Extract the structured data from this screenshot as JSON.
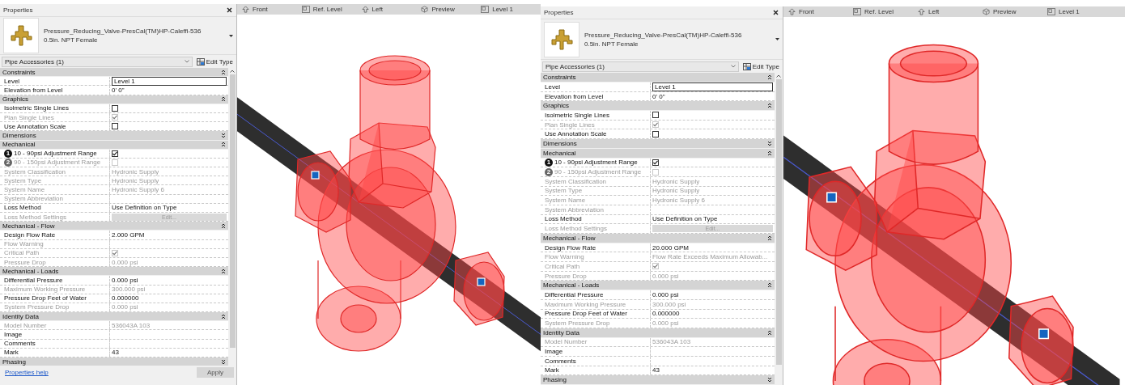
{
  "screens": [
    {
      "panel": {
        "title": "Properties",
        "family": "Pressure_Reducing_Valve-PresCal(TM)HP-Caleffi-536",
        "type": "0.5in. NPT Female",
        "category": "Pipe Accessories (1)",
        "edit_type": "Edit Type",
        "groups": [
          {
            "name": "Constraints",
            "expanded": true,
            "rows": [
              {
                "label": "Level",
                "kind": "field",
                "value": "Level 1",
                "disabled": false
              },
              {
                "label": "Elevation from Level",
                "kind": "text",
                "value": "0'  0\"",
                "disabled": false
              }
            ]
          },
          {
            "name": "Graphics",
            "expanded": true,
            "rows": [
              {
                "label": "Isolmetric Single Lines",
                "kind": "checkbox",
                "checked": false,
                "disabled": false
              },
              {
                "label": "Plan Single Lines",
                "kind": "checkbox",
                "checked": true,
                "disabled": true
              },
              {
                "label": "Use Annotation Scale",
                "kind": "checkbox",
                "checked": false,
                "disabled": false
              }
            ]
          },
          {
            "name": "Dimensions",
            "expanded": false
          },
          {
            "name": "Mechanical",
            "expanded": true,
            "rows": [
              {
                "label": "10 - 90psi Adjustment Range",
                "badge": "1",
                "kind": "checkbox",
                "checked": true,
                "disabled": false
              },
              {
                "label": "90 - 150psi Adjustment Range",
                "badge": "2",
                "kind": "checkbox",
                "checked": false,
                "disabled": true
              },
              {
                "label": "System Classification",
                "kind": "text",
                "value": "Hydronic Supply",
                "disabled": true
              },
              {
                "label": "System Type",
                "kind": "text",
                "value": "Hydronic Supply",
                "disabled": true
              },
              {
                "label": "System Name",
                "kind": "text",
                "value": "Hydronic Supply 6",
                "disabled": true
              },
              {
                "label": "System Abbreviation",
                "kind": "text",
                "disabled": true
              },
              {
                "label": "Loss Method",
                "kind": "text",
                "value": "Use Definition on Type",
                "disabled": false
              },
              {
                "label": "Loss Method Settings",
                "kind": "button",
                "value": "Edit...",
                "disabled": true
              }
            ]
          },
          {
            "name": "Mechanical - Flow",
            "expanded": true,
            "rows": [
              {
                "label": "Design Flow Rate",
                "kind": "text",
                "value": "2.000 GPM",
                "disabled": false
              },
              {
                "label": "Flow Warning",
                "kind": "text",
                "disabled": true
              },
              {
                "label": "Critical Path",
                "kind": "checkbox",
                "checked": true,
                "disabled": true
              },
              {
                "label": "Pressure Drop",
                "kind": "text",
                "value": "0.000 psi",
                "disabled": true
              }
            ]
          },
          {
            "name": "Mechanical - Loads",
            "expanded": true,
            "rows": [
              {
                "label": "Differential Pressure",
                "kind": "text",
                "value": "0.000 psi",
                "disabled": false
              },
              {
                "label": "Maximum Working Pressure",
                "kind": "text",
                "value": "300.000 psi",
                "disabled": true
              },
              {
                "label": "Pressure Drop Feet of Water",
                "kind": "text",
                "value": "0.000000",
                "disabled": false
              },
              {
                "label": "System Pressure Drop",
                "kind": "text",
                "value": "0.000 psi",
                "disabled": true
              }
            ]
          },
          {
            "name": "Identity Data",
            "expanded": true,
            "rows": [
              {
                "label": "Model Number",
                "kind": "text",
                "value": "536043A 103",
                "disabled": true
              },
              {
                "label": "Image",
                "kind": "text",
                "disabled": false
              },
              {
                "label": "Comments",
                "kind": "text",
                "disabled": false
              },
              {
                "label": "Mark",
                "kind": "text",
                "value": "43",
                "disabled": false
              }
            ]
          },
          {
            "name": "Phasing",
            "expanded": false
          }
        ],
        "footer": {
          "help_link": "Properties help",
          "apply": {
            "label": "Apply",
            "disabled": true
          }
        }
      },
      "viewport": {
        "tabs": [
          {
            "label": "Front"
          },
          {
            "label": "Ref. Level"
          },
          {
            "label": "Left"
          },
          {
            "label": "Preview"
          },
          {
            "label": "Level 1"
          }
        ]
      }
    },
    {
      "panel": {
        "title": "Properties",
        "family": "Pressure_Reducing_Valve-PresCal(TM)HP-Caleffi-536",
        "type": "0.5in. NPT Female",
        "category": "Pipe Accessories (1)",
        "edit_type": "Edit Type",
        "groups": [
          {
            "name": "Constraints",
            "expanded": true,
            "rows": [
              {
                "label": "Level",
                "kind": "field",
                "value": "Level 1",
                "disabled": false
              },
              {
                "label": "Elevation from Level",
                "kind": "text",
                "value": "0'  0\"",
                "disabled": false
              }
            ]
          },
          {
            "name": "Graphics",
            "expanded": true,
            "rows": [
              {
                "label": "Isolmetric Single Lines",
                "kind": "checkbox",
                "checked": false,
                "disabled": false
              },
              {
                "label": "Plan Single Lines",
                "kind": "checkbox",
                "checked": true,
                "disabled": true
              },
              {
                "label": "Use Annotation Scale",
                "kind": "checkbox",
                "checked": false,
                "disabled": false
              }
            ]
          },
          {
            "name": "Dimensions",
            "expanded": false
          },
          {
            "name": "Mechanical",
            "expanded": true,
            "rows": [
              {
                "label": "10 - 90psi Adjustment Range",
                "badge": "1",
                "kind": "checkbox",
                "checked": true,
                "disabled": false
              },
              {
                "label": "90 - 150psi Adjustment Range",
                "badge": "2",
                "kind": "checkbox",
                "checked": false,
                "disabled": true
              },
              {
                "label": "System Classification",
                "kind": "text",
                "value": "Hydronic Supply",
                "disabled": true
              },
              {
                "label": "System Type",
                "kind": "text",
                "value": "Hydronic Supply",
                "disabled": true
              },
              {
                "label": "System Name",
                "kind": "text",
                "value": "Hydronic Supply 6",
                "disabled": true
              },
              {
                "label": "System Abbreviation",
                "kind": "text",
                "disabled": true
              },
              {
                "label": "Loss Method",
                "kind": "text",
                "value": "Use Definition on Type",
                "disabled": false
              },
              {
                "label": "Loss Method Settings",
                "kind": "button",
                "value": "Edit...",
                "disabled": true
              }
            ]
          },
          {
            "name": "Mechanical - Flow",
            "expanded": true,
            "rows": [
              {
                "label": "Design Flow Rate",
                "kind": "text",
                "value": "20.000 GPM",
                "disabled": false
              },
              {
                "label": "Flow Warning",
                "kind": "text",
                "value": "Flow Rate Exceeds Maximum Allowab...",
                "disabled": true
              },
              {
                "label": "Critical Path",
                "kind": "checkbox",
                "checked": true,
                "disabled": true
              },
              {
                "label": "Pressure Drop",
                "kind": "text",
                "value": "0.000 psi",
                "disabled": true
              }
            ]
          },
          {
            "name": "Mechanical - Loads",
            "expanded": true,
            "rows": [
              {
                "label": "Differential Pressure",
                "kind": "text",
                "value": "0.000 psi",
                "disabled": false
              },
              {
                "label": "Maximum Working Pressure",
                "kind": "text",
                "value": "300.000 psi",
                "disabled": true
              },
              {
                "label": "Pressure Drop Feet of Water",
                "kind": "text",
                "value": "0.000000",
                "disabled": false
              },
              {
                "label": "System Pressure Drop",
                "kind": "text",
                "value": "0.000 psi",
                "disabled": true
              }
            ]
          },
          {
            "name": "Identity Data",
            "expanded": true,
            "rows": [
              {
                "label": "Model Number",
                "kind": "text",
                "value": "536043A 103",
                "disabled": true
              },
              {
                "label": "Image",
                "kind": "text",
                "disabled": false
              },
              {
                "label": "Comments",
                "kind": "text",
                "disabled": false
              },
              {
                "label": "Mark",
                "kind": "text",
                "value": "43",
                "disabled": false
              }
            ]
          },
          {
            "name": "Phasing",
            "expanded": false
          }
        ]
      },
      "viewport": {
        "tabs": [
          {
            "label": "Front"
          },
          {
            "label": "Ref. Level"
          },
          {
            "label": "Left"
          },
          {
            "label": "Preview"
          },
          {
            "label": "Level 1"
          }
        ]
      }
    }
  ]
}
